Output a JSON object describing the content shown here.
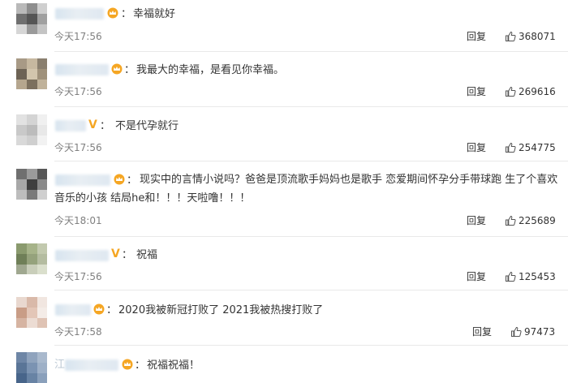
{
  "colors": {
    "text": "#333333",
    "time": "#808080",
    "badge": "#f5a623",
    "separator": "#e9e9e9"
  },
  "comments": [
    {
      "badge": "crown-icon",
      "text": "幸福就好",
      "time": "今天17:56",
      "reply_label": "回复",
      "likes": "368071"
    },
    {
      "badge": "crown-icon",
      "text": "我最大的幸福，是看见你幸福。",
      "time": "今天17:56",
      "reply_label": "回复",
      "likes": "269616"
    },
    {
      "badge": "v-icon",
      "text": "不是代孕就行",
      "time": "今天17:56",
      "reply_label": "回复",
      "likes": "254775"
    },
    {
      "badge": "crown-icon",
      "text": "现实中的言情小说吗？爸爸是顶流歌手妈妈也是歌手 恋爱期间怀孕分手带球跑 生了个喜欢",
      "text_line2": "音乐的小孩 结局he和！！！天啦噜！！！",
      "time": "今天18:01",
      "reply_label": "回复",
      "likes": "225689"
    },
    {
      "badge": "v-icon",
      "text": "祝福",
      "time": "今天17:56",
      "reply_label": "回复",
      "likes": "125453"
    },
    {
      "badge": "crown-icon",
      "text": "2020我被新冠打败了 2021我被热搜打败了",
      "time": "今天17:58",
      "reply_label": "回复",
      "likes": "97473"
    },
    {
      "badge": "crown-icon",
      "text": "祝福祝福！",
      "name_prefix": "江"
    }
  ]
}
